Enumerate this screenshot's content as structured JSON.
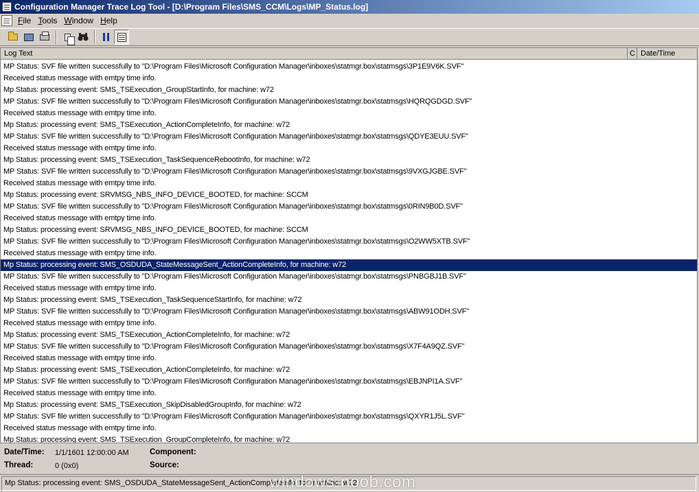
{
  "window": {
    "title": "Configuration Manager Trace Log Tool - [D:\\Program Files\\SMS_CCM\\Logs\\MP_Status.log]"
  },
  "menu": [
    {
      "label": "File",
      "accel": "F",
      "rest": "ile"
    },
    {
      "label": "Tools",
      "accel": "T",
      "rest": "ools"
    },
    {
      "label": "Window",
      "accel": "W",
      "rest": "indow"
    },
    {
      "label": "Help",
      "accel": "H",
      "rest": "elp"
    }
  ],
  "toolbar": {
    "icons": [
      "open-icon",
      "computer-icon",
      "print-icon",
      "copy-icon",
      "find-icon",
      "pause-icon",
      "highlight-icon"
    ]
  },
  "log": {
    "columns": {
      "log_text": "Log Text",
      "component": "C",
      "datetime": "Date/Time"
    },
    "selected_index": 17,
    "rows": [
      "MP Status: SVF file written successfully to \"D:\\Program Files\\Microsoft Configuration Manager\\inboxes\\statmgr.box\\statmsgs\\3P1E9V6K.SVF\"",
      "Received status message with emtpy time info.",
      "Mp Status: processing event: SMS_TSExecution_GroupStartInfo, for machine: w72",
      "MP Status: SVF file written successfully to \"D:\\Program Files\\Microsoft Configuration Manager\\inboxes\\statmgr.box\\statmsgs\\HQRQGDGD.SVF\"",
      "Received status message with emtpy time info.",
      "Mp Status: processing event: SMS_TSExecution_ActionCompleteInfo, for machine: w72",
      "MP Status: SVF file written successfully to \"D:\\Program Files\\Microsoft Configuration Manager\\inboxes\\statmgr.box\\statmsgs\\QDYE3EUU.SVF\"",
      "Received status message with emtpy time info.",
      "Mp Status: processing event: SMS_TSExecution_TaskSequenceRebootInfo, for machine: w72",
      "MP Status: SVF file written successfully to \"D:\\Program Files\\Microsoft Configuration Manager\\inboxes\\statmgr.box\\statmsgs\\9VXGJGBE.SVF\"",
      "Received status message with emtpy time info.",
      "Mp Status: processing event: SRVMSG_NBS_INFO_DEVICE_BOOTED, for machine: SCCM",
      "MP Status: SVF file written successfully to \"D:\\Program Files\\Microsoft Configuration Manager\\inboxes\\statmgr.box\\statmsgs\\0RIN9B0D.SVF\"",
      "Received status message with emtpy time info.",
      "Mp Status: processing event: SRVMSG_NBS_INFO_DEVICE_BOOTED, for machine: SCCM",
      "MP Status: SVF file written successfully to \"D:\\Program Files\\Microsoft Configuration Manager\\inboxes\\statmgr.box\\statmsgs\\O2WW5XTB.SVF\"",
      "Received status message with emtpy time info.",
      "Mp Status: processing event: SMS_OSDUDA_StateMessageSent_ActionCompleteInfo, for machine: w72",
      "MP Status: SVF file written successfully to \"D:\\Program Files\\Microsoft Configuration Manager\\inboxes\\statmgr.box\\statmsgs\\PNBGBJ1B.SVF\"",
      "Received status message with emtpy time info.",
      "Mp Status: processing event: SMS_TSExecution_TaskSequenceStartInfo, for machine: w72",
      "MP Status: SVF file written successfully to \"D:\\Program Files\\Microsoft Configuration Manager\\inboxes\\statmgr.box\\statmsgs\\ABW91ODH.SVF\"",
      "Received status message with emtpy time info.",
      "Mp Status: processing event: SMS_TSExecution_ActionCompleteInfo, for machine: w72",
      "MP Status: SVF file written successfully to \"D:\\Program Files\\Microsoft Configuration Manager\\inboxes\\statmgr.box\\statmsgs\\X7F4A9QZ.SVF\"",
      "Received status message with emtpy time info.",
      "Mp Status: processing event: SMS_TSExecution_ActionCompleteInfo, for machine: w72",
      "MP Status: SVF file written successfully to \"D:\\Program Files\\Microsoft Configuration Manager\\inboxes\\statmgr.box\\statmsgs\\EBJNPI1A.SVF\"",
      "Received status message with emtpy time info.",
      "Mp Status: processing event: SMS_TSExecution_SkipDisabledGroupInfo, for machine: w72",
      "MP Status: SVF file written successfully to \"D:\\Program Files\\Microsoft Configuration Manager\\inboxes\\statmgr.box\\statmsgs\\QXYR1J5L.SVF\"",
      "Received status message with emtpy time info.",
      "Mp Status: processing event: SMS_TSExecution_GroupCompleteInfo, for machine: w72"
    ]
  },
  "details": {
    "datetime_label": "Date/Time:",
    "datetime_value": "1/1/1601 12:00:00 AM",
    "component_label": "Component:",
    "component_value": "",
    "thread_label": "Thread:",
    "thread_value": "0 (0x0)",
    "source_label": "Source:",
    "source_value": ""
  },
  "status": {
    "message": "Mp Status: processing event: SMS_OSDUDA_StateMessageSent_ActionCompleteInfo, for machine: w72"
  },
  "watermark": "windows-noob.com",
  "colors": {
    "selection": "#0a246a",
    "chrome": "#d4d0c8"
  }
}
